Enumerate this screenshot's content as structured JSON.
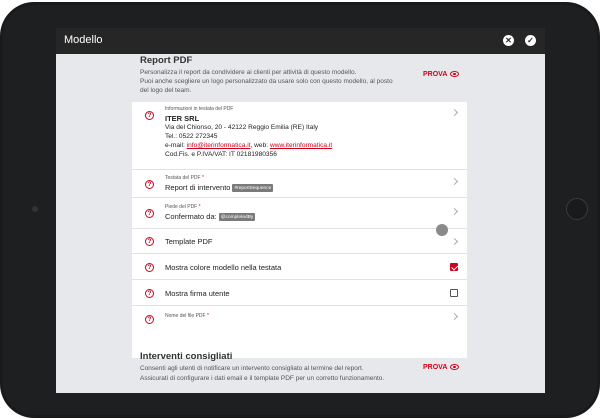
{
  "window": {
    "title": "Modello"
  },
  "titlebar": {
    "close_glyph": "✕",
    "confirm_glyph": "✓"
  },
  "report_pdf": {
    "title": "Report PDF",
    "desc_line1": "Personalizza il report da condividere ai clienti per attività di questo modello.",
    "desc_line2": "Puoi anche scegliere un logo personalizzato da usare solo con questo modello, al posto",
    "desc_line3": "del logo del team.",
    "prova": "PROVA"
  },
  "rows": {
    "header_info": {
      "label": "Informazioni in testata del PDF",
      "company": "ITER SRL",
      "address": "Via del Chionso, 20 - 42122 Reggio Emilia (RE) Italy",
      "phone": "Tel.: 0522 272345",
      "email_prefix": "e-mail: ",
      "email": "info@iterinformatica.it",
      "web_prefix": ", web: ",
      "web": "www.iterinformatica.it",
      "tax": "Cod.Fis. e P.IVA/VAT: IT 02181980356"
    },
    "pdf_title": {
      "label": "Testata del PDF",
      "req": "*",
      "value": "Report di intervento",
      "chip": "#reportSequence"
    },
    "pdf_footer": {
      "label": "Piede del PDF",
      "req": "*",
      "value": "Confermato da:",
      "chip": "@completedBy"
    },
    "template_pdf": {
      "label": "Template PDF"
    },
    "show_color": {
      "label": "Mostra colore modello nella testata",
      "checked": true
    },
    "show_signature": {
      "label": "Mostra firma utente",
      "checked": false
    },
    "file_name": {
      "label": "Nome del file PDF",
      "req": "*"
    }
  },
  "interventi": {
    "title": "Interventi consigliati",
    "desc_line1": "Consenti agli utenti di notificare un intervento consigliato al termine del report.",
    "desc_line2": "Assicurati di configurare i dati email e il template PDF per un corretto funzionamento.",
    "prova": "PROVA"
  },
  "colors": {
    "accent": "#d0021b",
    "titlebar": "#262626",
    "background": "#e6e8eb"
  },
  "icons": [
    "close-icon",
    "check-icon",
    "eye-icon",
    "help-icon",
    "chevron-right-icon",
    "checkbox-icon"
  ]
}
